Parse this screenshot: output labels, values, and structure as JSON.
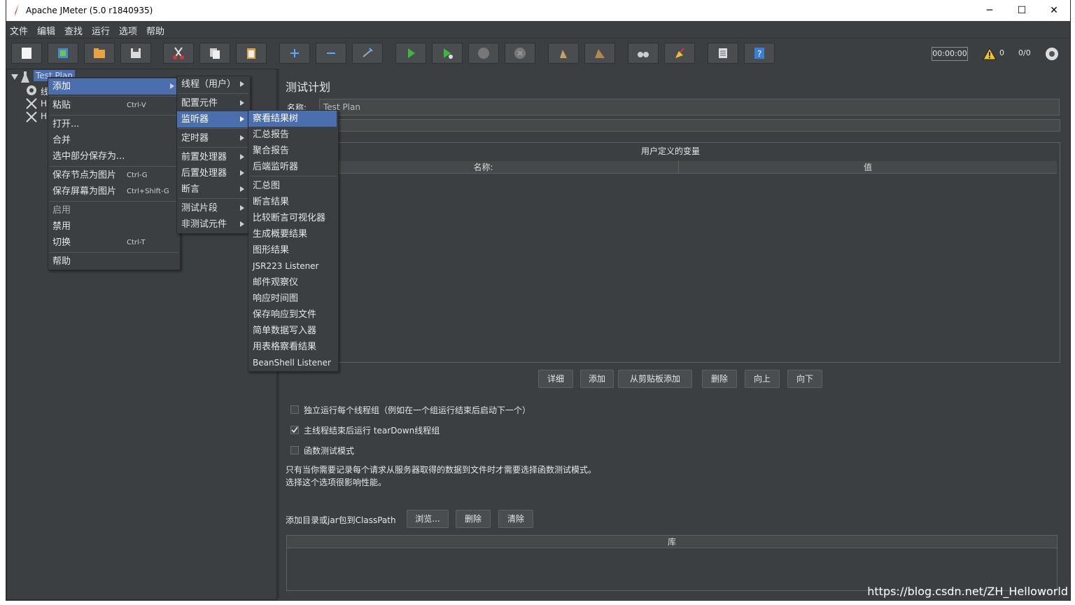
{
  "window": {
    "title": "Apache JMeter (5.0 r1840935)",
    "controls": [
      "─",
      "☐",
      "✕"
    ]
  },
  "menubar": [
    "文件",
    "编辑",
    "查找",
    "运行",
    "选项",
    "帮助"
  ],
  "toolbar": {
    "timer": "00:00:00",
    "warning_count": "0",
    "thread_ratio": "0/0"
  },
  "tree": {
    "root_label": "Test Plan",
    "child1_label": "线",
    "child2_label": "H",
    "child3_label": "H"
  },
  "context_menu": {
    "items": [
      {
        "label": "添加",
        "shortcut": ""
      },
      {
        "label": "粘贴",
        "shortcut": "Ctrl-V"
      },
      {
        "label": "打开...",
        "shortcut": ""
      },
      {
        "label": "合并",
        "shortcut": ""
      },
      {
        "label": "选中部分保存为...",
        "shortcut": ""
      },
      {
        "label": "保存节点为图片",
        "shortcut": "Ctrl-G"
      },
      {
        "label": "保存屏幕为图片",
        "shortcut": "Ctrl+Shift-G"
      },
      {
        "label": "启用",
        "shortcut": ""
      },
      {
        "label": "禁用",
        "shortcut": ""
      },
      {
        "label": "切换",
        "shortcut": "Ctrl-T"
      },
      {
        "label": "帮助",
        "shortcut": ""
      }
    ]
  },
  "add_submenu": [
    "线程（用户）",
    "配置元件",
    "监听器",
    "定时器",
    "前置处理器",
    "后置处理器",
    "断言",
    "测试片段",
    "非测试元件"
  ],
  "listener_submenu": [
    "察看结果树",
    "汇总报告",
    "聚合报告",
    "后端监听器",
    "汇总图",
    "断言结果",
    "比较断言可视化器",
    "生成概要结果",
    "图形结果",
    "JSR223 Listener",
    "邮件观察仪",
    "响应时间图",
    "保存响应到文件",
    "简单数据写入器",
    "用表格察看结果",
    "BeanShell Listener"
  ],
  "panel": {
    "title": "测试计划",
    "name_label": "名称:",
    "name_value": "Test Plan",
    "vars_title": "用户定义的变量",
    "col_name": "名称:",
    "col_value": "值",
    "buttons": [
      "详细",
      "添加",
      "从剪贴板添加",
      "删除",
      "向上",
      "向下"
    ],
    "checks": [
      {
        "label": "独立运行每个线程组（例如在一个组运行结束后启动下一个）",
        "checked": false
      },
      {
        "label": "主线程结束后运行 tearDown线程组",
        "checked": true
      },
      {
        "label": "函数测试模式",
        "checked": false
      }
    ],
    "note_line1": "只有当你需要记录每个请求从服务器取得的数据到文件时才需要选择函数测试模式。",
    "note_line2": "选择这个选项很影响性能。",
    "classpath_label": "添加目录或jar包到ClassPath",
    "classpath_buttons": [
      "浏览...",
      "删除",
      "清除"
    ],
    "lib_header": "库"
  },
  "watermark": "https://blog.csdn.net/ZH_Helloworld"
}
